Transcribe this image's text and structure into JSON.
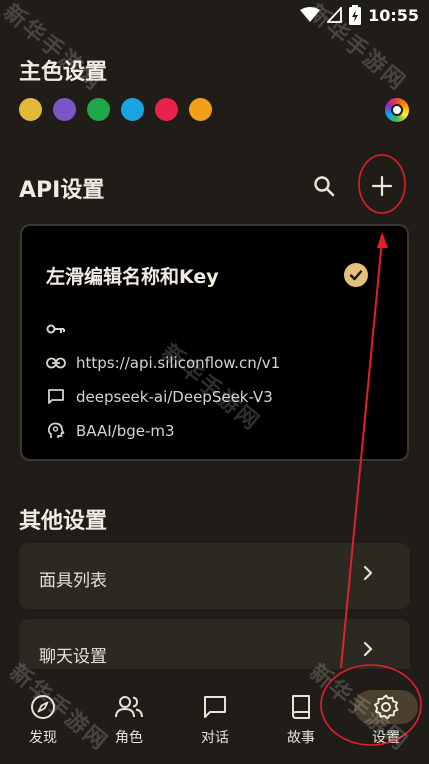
{
  "status_bar": {
    "time": "10:55"
  },
  "theme": {
    "title": "主色设置",
    "colors": [
      "#e1b93a",
      "#7b56c6",
      "#1fa84a",
      "#1aa4e3",
      "#e6234d",
      "#f2a01b"
    ],
    "palette_icon": "palette-icon"
  },
  "api": {
    "title": "API设置",
    "search_icon": "search-icon",
    "add_icon": "plus-icon",
    "card": {
      "title": "左滑编辑名称和Key",
      "key_value": "",
      "url": "https://api.siliconflow.cn/v1",
      "chat_model": "deepseek-ai/DeepSeek-V3",
      "embed_model": "BAAI/bge-m3",
      "selected": true
    }
  },
  "other": {
    "title": "其他设置",
    "items": [
      {
        "label": "面具列表"
      },
      {
        "label": "聊天设置"
      }
    ]
  },
  "nav": {
    "items": [
      {
        "label": "发现",
        "icon": "compass-icon"
      },
      {
        "label": "角色",
        "icon": "people-icon"
      },
      {
        "label": "对话",
        "icon": "chat-icon"
      },
      {
        "label": "故事",
        "icon": "book-icon"
      },
      {
        "label": "设置",
        "icon": "gear-icon",
        "active": true
      }
    ]
  },
  "watermarks": [
    "新华手游网",
    "新华手游网",
    "新华手游网",
    "新华手游网",
    "新华手游网"
  ],
  "annotation_color": "#e0212a"
}
